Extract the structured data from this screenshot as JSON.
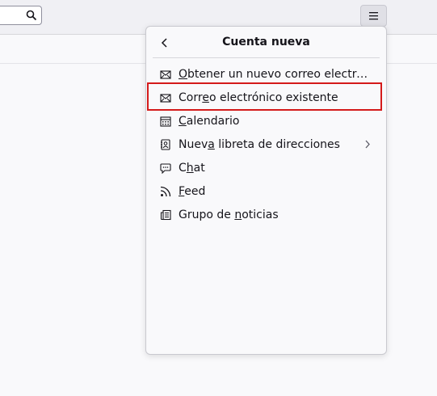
{
  "panel": {
    "title": "Cuenta nueva",
    "items": [
      {
        "pre": "",
        "u": "O",
        "post": "btener un nuevo correo electrónico",
        "icon": "mail-new-icon"
      },
      {
        "pre": "Corr",
        "u": "e",
        "post": "o electrónico existente",
        "icon": "mail-icon"
      },
      {
        "pre": "",
        "u": "C",
        "post": "alendario",
        "icon": "calendar-icon"
      },
      {
        "pre": "Nuev",
        "u": "a",
        "post": " libreta de direcciones",
        "icon": "address-book-icon",
        "submenu": true
      },
      {
        "pre": "C",
        "u": "h",
        "post": "at",
        "icon": "chat-icon"
      },
      {
        "pre": "",
        "u": "F",
        "post": "eed",
        "icon": "feed-icon"
      },
      {
        "pre": "Grupo de ",
        "u": "n",
        "post": "oticias",
        "icon": "newsgroup-icon"
      }
    ]
  },
  "highlight_color": "#d41a1a"
}
